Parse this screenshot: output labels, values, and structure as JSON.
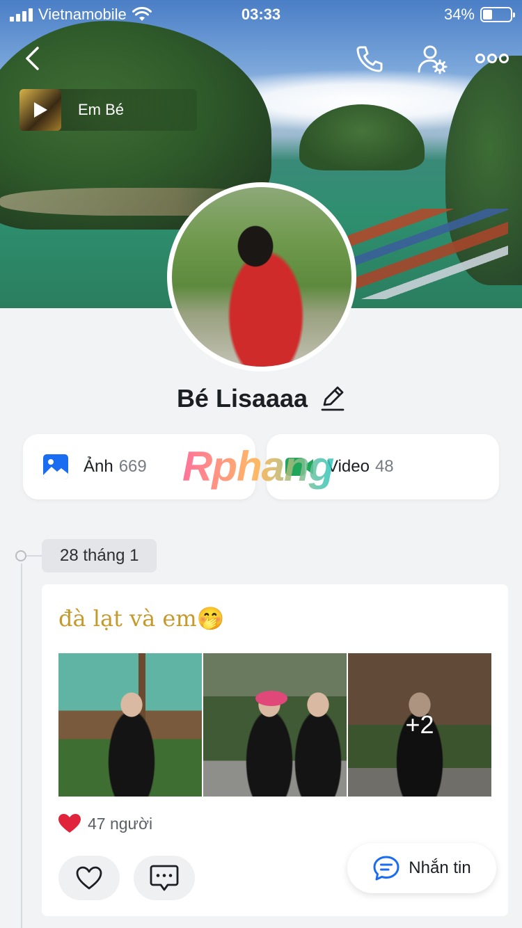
{
  "status_bar": {
    "carrier": "Vietnamobile",
    "time": "03:33",
    "battery_text": "34%",
    "battery_level": 0.34
  },
  "music": {
    "title": "Em Bé"
  },
  "profile": {
    "name": "Bé Lisaaaa"
  },
  "stats": {
    "photo_label": "Ảnh",
    "photo_count": "669",
    "video_label": "Video",
    "video_count": "48"
  },
  "watermark": "Rphang",
  "timeline": {
    "date": "28 tháng 1"
  },
  "post": {
    "caption": "đà lạt và em🤭",
    "more_photos": "+2",
    "likes_text": "47 người"
  },
  "message_button": {
    "label": "Nhắn tin"
  },
  "colors": {
    "accent": "#1a6cf0",
    "caption": "#c59a2c",
    "heart": "#e0243b",
    "page_bg": "#f2f3f5"
  },
  "icons": [
    "back-icon",
    "phone-icon",
    "user-settings-icon",
    "more-icon",
    "play-icon",
    "edit-icon",
    "image-icon",
    "video-icon",
    "heart-icon",
    "heart-outline-icon",
    "comment-icon",
    "chat-icon",
    "wifi-icon"
  ]
}
